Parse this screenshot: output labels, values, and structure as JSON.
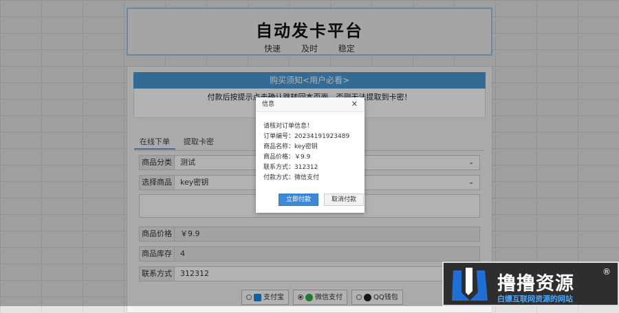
{
  "header": {
    "title": "自动发卡平台",
    "subtitle": "快速 及时 稳定"
  },
  "notice": {
    "heading": "购买须知<用户必看>",
    "text": "付款后按提示点击确认跳转回本页面，否则无法提取到卡密！"
  },
  "tabs": [
    {
      "label": "在线下单"
    },
    {
      "label": "提取卡密"
    }
  ],
  "form": {
    "category": {
      "label": "商品分类",
      "value": "测试"
    },
    "product": {
      "label": "选择商品",
      "value": "key密钥"
    },
    "price": {
      "label": "商品价格",
      "value": "￥9.9"
    },
    "stock": {
      "label": "商品库存",
      "value": "4"
    },
    "contact": {
      "label": "联系方式",
      "value": "312312"
    }
  },
  "payment": {
    "options": [
      {
        "label": "支付宝",
        "selected": false
      },
      {
        "label": "微信支付",
        "selected": true
      },
      {
        "label": "QQ钱包",
        "selected": false
      }
    ]
  },
  "dialog": {
    "title": "信息",
    "lines": [
      "请核对订单信息！",
      "订单编号：20234191923489",
      "商品名称：key密钥",
      "商品价格：￥9.9",
      "联系方式：312312",
      "付款方式：微信支付"
    ],
    "confirm_label": "立即付款",
    "cancel_label": "取消付款"
  },
  "watermark": {
    "title": "撸撸资源",
    "tagline": "白嫖互联网资源的网站",
    "reg": "®"
  },
  "colors": {
    "accent": "#4a9ad6",
    "primary_button": "#3f88d8",
    "watermark_blue": "#1f6fd6"
  }
}
